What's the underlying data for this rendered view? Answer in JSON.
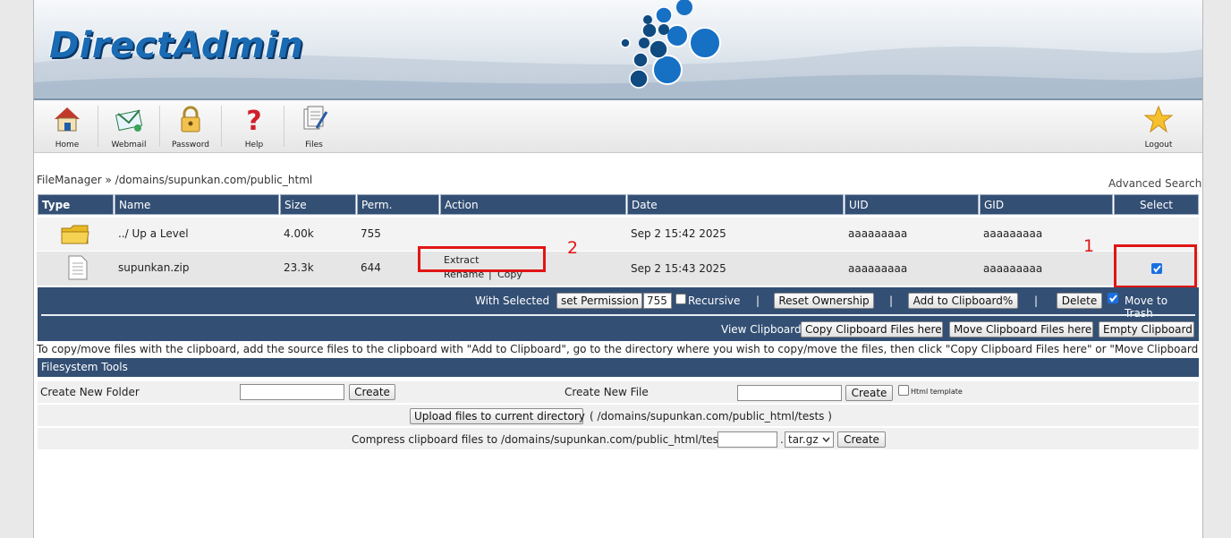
{
  "brand": {
    "logo_text": "DirectAdmin"
  },
  "toolbar": [
    {
      "label": "Home",
      "icon": "home-icon"
    },
    {
      "label": "Webmail",
      "icon": "webmail-icon"
    },
    {
      "label": "Password",
      "icon": "password-icon"
    },
    {
      "label": "Help",
      "icon": "help-icon"
    },
    {
      "label": "Files",
      "icon": "files-icon"
    },
    {
      "label": "Logout",
      "icon": "logout-icon"
    }
  ],
  "breadcrumb": "FileManager » /domains/supunkan.com/public_html",
  "advanced_search": "Advanced Search",
  "table": {
    "headers": [
      "Type",
      "Name",
      "Size",
      "Perm.",
      "Action",
      "Date",
      "UID",
      "GID",
      "Select"
    ],
    "rows": [
      {
        "type_icon": "folder-icon",
        "name": "../ Up a Level",
        "size": "4.00k",
        "perm": "755",
        "date": "Sep 2 15:42 2025",
        "uid": "aaaaaaaaa",
        "gid": "aaaaaaaaa"
      },
      {
        "type_icon": "file-icon",
        "name": "supunkan.zip",
        "size": "23.3k",
        "perm": "644",
        "action_extract": "Extract",
        "action_rename": "Rename",
        "action_sep": "|",
        "action_copy": "Copy",
        "date": "Sep 2 15:43 2025",
        "uid": "aaaaaaaaa",
        "gid": "aaaaaaaaa",
        "selected": true
      }
    ]
  },
  "annotations": {
    "one": "1",
    "two": "2",
    "color": "#e11515"
  },
  "with_selected": {
    "label": "With Selected",
    "set_permission": "set Permission",
    "perm_value": "755",
    "recursive": "Recursive",
    "sep": "|",
    "reset_ownership": "Reset Ownership",
    "add_clipboard": "Add to Clipboard%",
    "delete": "Delete",
    "move_to_trash": "Move to Trash",
    "move_to_trash_checked": true
  },
  "clipboard": {
    "label": "View Clipboard",
    "copy": "Copy Clipboard Files here",
    "move": "Move Clipboard Files here",
    "empty": "Empty Clipboard"
  },
  "note": "To copy/move files with the clipboard, add the source files to the clipboard with \"Add to Clipboard\", go to the directory where you wish to copy/move the files, then click \"Copy Clipboard Files here\" or \"Move Clipboard Files here\"",
  "fs_tools": {
    "title": "Filesystem Tools",
    "new_folder_label": "Create New Folder",
    "create": "Create",
    "new_file_label": "Create New File",
    "html_template": "Html template",
    "upload_button": "Upload files to current directory",
    "upload_path": "( /domains/supunkan.com/public_html/tests )",
    "compress_label": "Compress clipboard files to /domains/supunkan.com/public_html/tests/",
    "compress_dot": ".",
    "compress_ext": "tar.gz"
  },
  "colors": {
    "header_bg": "#334f74",
    "brand_blue": "#1a6bb3",
    "highlight_red": "#e11515"
  }
}
